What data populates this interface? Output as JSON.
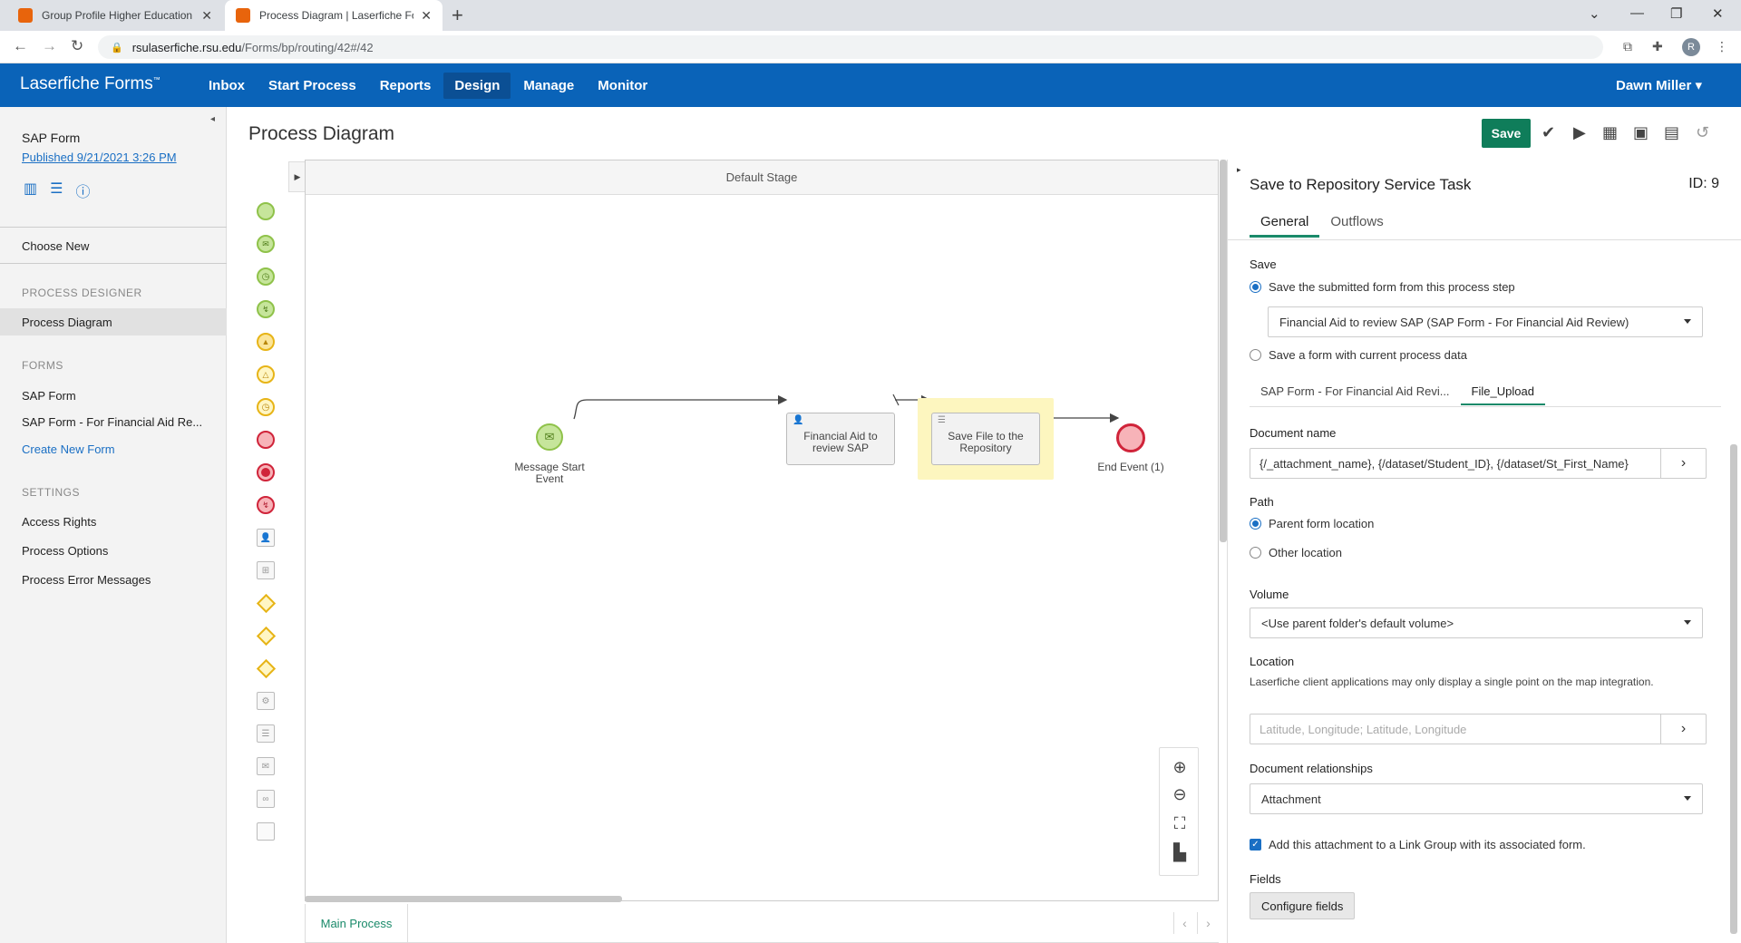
{
  "browser": {
    "tabs": [
      {
        "title": "Group Profile Higher Education -",
        "favicon_color": "#e8640c"
      },
      {
        "title": "Process Diagram | Laserfiche For",
        "favicon_color": "#e8640c"
      }
    ],
    "url_host": "rsulaserfiche.rsu.edu",
    "url_path": "/Forms/bp/routing/42#/42",
    "profile_initial": "R"
  },
  "app": {
    "brand": "Laserfiche Forms",
    "brand_tm": "™",
    "nav": [
      "Inbox",
      "Start Process",
      "Reports",
      "Design",
      "Manage",
      "Monitor"
    ],
    "active_nav": "Design",
    "user": "Dawn Miller ▾"
  },
  "sidebar": {
    "form_name": "SAP Form",
    "published": "Published 9/21/2021 3:26 PM",
    "choose_new": "Choose New",
    "sections": {
      "process_designer": "PROCESS DESIGNER",
      "forms": "FORMS",
      "settings": "SETTINGS"
    },
    "process_diagram": "Process Diagram",
    "forms": [
      "SAP Form",
      "SAP Form - For Financial Aid Re..."
    ],
    "create_new_form": "Create New Form",
    "settings": [
      "Access Rights",
      "Process Options",
      "Process Error Messages"
    ]
  },
  "page": {
    "title": "Process Diagram",
    "save": "Save"
  },
  "diagram": {
    "stage": "Default Stage",
    "nodes": {
      "start": "Message Start Event",
      "task1": "Financial Aid to review SAP",
      "task2": "Save File to the Repository",
      "end": "End Event (1)"
    },
    "bottom_tab": "Main Process"
  },
  "panel": {
    "title": "Save to Repository Service Task",
    "id": "ID: 9",
    "tabs": [
      "General",
      "Outflows"
    ],
    "save_label": "Save",
    "radio_submitted": "Save the submitted form from this process step",
    "submitted_select": "Financial Aid to review SAP (SAP Form - For Financial Aid Review)",
    "radio_current": "Save a form with current process data",
    "form_tabs": [
      "SAP Form - For Financial Aid Revi...",
      "File_Upload"
    ],
    "doc_name_label": "Document name",
    "doc_name_value": "{/_attachment_name}, {/dataset/Student_ID}, {/dataset/St_First_Name}",
    "path_label": "Path",
    "path_parent": "Parent form location",
    "path_other": "Other location",
    "volume_label": "Volume",
    "volume_value": "<Use parent folder's default volume>",
    "location_label": "Location",
    "location_help": "Laserfiche client applications may only display a single point on the map integration.",
    "location_placeholder": "Latitude, Longitude; Latitude, Longitude",
    "rel_label": "Document relationships",
    "rel_value": "Attachment",
    "link_group": "Add this attachment to a Link Group with its associated form.",
    "fields_label": "Fields",
    "configure_fields": "Configure fields"
  }
}
